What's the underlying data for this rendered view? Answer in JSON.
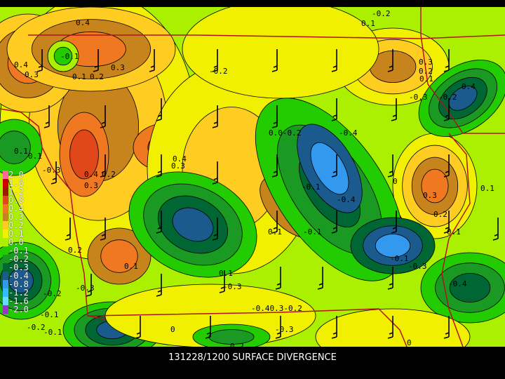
{
  "caption": "131228/1200 SURFACE DIVERGENCE",
  "legend": [
    {
      "label": "2.0",
      "color": "#ff6699"
    },
    {
      "label": "1.6",
      "color": "#cc0000"
    },
    {
      "label": "1.2",
      "color": "#991a00"
    },
    {
      "label": "0.8",
      "color": "#e0481c"
    },
    {
      "label": "0.4",
      "color": "#f07820"
    },
    {
      "label": "0.3",
      "color": "#c8841c"
    },
    {
      "label": "0.2",
      "color": "#ffcc22"
    },
    {
      "label": "0.1",
      "color": "#f0f000"
    },
    {
      "label": "0.0",
      "color": "#aaf000"
    },
    {
      "label": "-0.1",
      "color": "#22cc00"
    },
    {
      "label": "-0.2",
      "color": "#1a9a22"
    },
    {
      "label": "-0.3",
      "color": "#006633"
    },
    {
      "label": "-0.4",
      "color": "#1a5a8c"
    },
    {
      "label": "-0.8",
      "color": "#3399ee"
    },
    {
      "label": "-1.2",
      "color": "#33bbff"
    },
    {
      "label": "-1.6",
      "color": "#66ddff"
    },
    {
      "label": "-2.0",
      "color": "#9933cc"
    }
  ],
  "contour_labels": [
    "0.4",
    "-0.2",
    "0.1",
    "-0.1",
    "0.4",
    "0.3",
    "0.1",
    "0.2",
    "0.3",
    "-0.2",
    "-0.2",
    "0.3",
    "0.2",
    "0.1",
    "-0.3",
    "0.0-0.2",
    "0.4",
    "0.1",
    "-0.4",
    "0.4",
    "0.3",
    "0.4",
    "0.2",
    "0.3",
    "-0.1",
    "0.3",
    "0.1",
    "-0.4",
    "0.2",
    "0.1",
    "-0.1",
    "0.1",
    "0.2",
    "0.1",
    "0.1",
    "-0.3",
    "-0.1",
    "-0.3",
    "-0.4",
    "-0.3",
    "-0.2",
    "-0.40.3-0.2",
    "-0.3",
    "-0.1",
    "-0.2",
    "-0.1",
    "0",
    "0",
    "0.2",
    "-0.3",
    "0.1",
    "0"
  ]
}
